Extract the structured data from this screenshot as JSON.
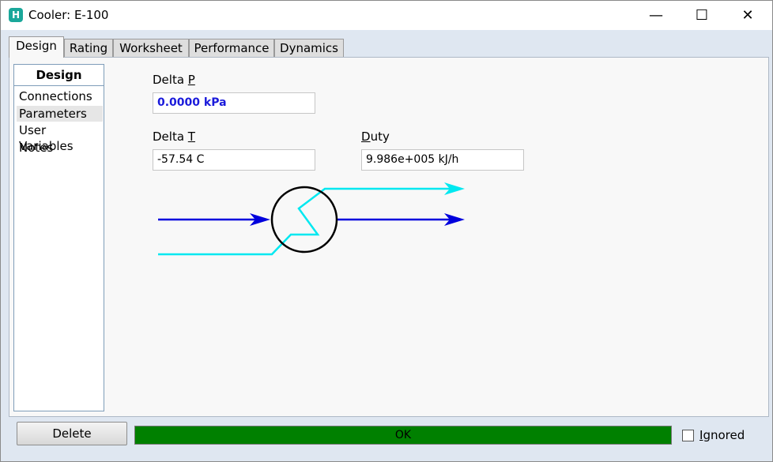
{
  "window": {
    "title": "Cooler: E-100",
    "icon_letter": "H",
    "minimize_glyph": "—",
    "maximize_glyph": "☐",
    "close_glyph": "✕"
  },
  "tabs": [
    {
      "label": "Design",
      "active": true
    },
    {
      "label": "Rating",
      "active": false
    },
    {
      "label": "Worksheet",
      "active": false
    },
    {
      "label": "Performance",
      "active": false
    },
    {
      "label": "Dynamics",
      "active": false
    }
  ],
  "sidebar": {
    "header": "Design",
    "items": [
      {
        "label": "Connections",
        "selected": false
      },
      {
        "label": "Parameters",
        "selected": true
      },
      {
        "label": "User Variables",
        "selected": false
      },
      {
        "label": "Notes",
        "selected": false
      }
    ]
  },
  "parameters": {
    "delta_p": {
      "label_pre": "Delta ",
      "label_key": "P",
      "value": "0.0000 kPa"
    },
    "delta_t": {
      "label_pre": "Delta ",
      "label_key": "T",
      "value": "-57.54 C"
    },
    "duty": {
      "label_pre": "",
      "label_key": "D",
      "label_post": "uty",
      "value": "9.986e+005 kJ/h"
    }
  },
  "diagram": {
    "stream_color_process": "#0000dd",
    "stream_color_energy": "#00e8f0",
    "icon": "cooler-icon"
  },
  "footer": {
    "delete_label": "Delete",
    "status_text": "OK",
    "status_color": "#008000",
    "ignored_key": "I",
    "ignored_rest": "gnored",
    "ignored_checked": false
  }
}
